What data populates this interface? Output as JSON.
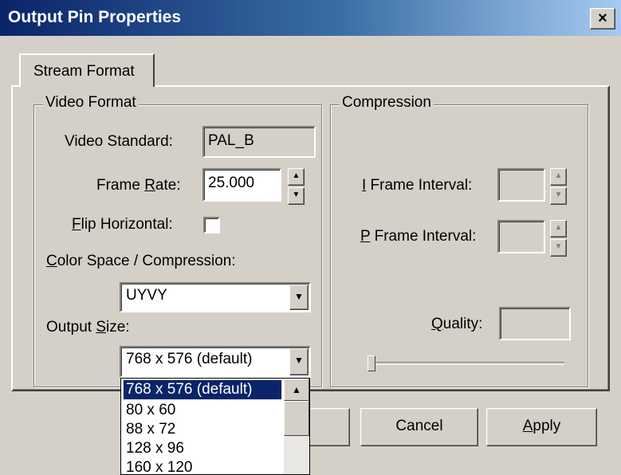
{
  "window": {
    "title": "Output Pin Properties",
    "close_glyph": "×"
  },
  "tabs": [
    {
      "label": "Stream Format"
    }
  ],
  "video_format": {
    "legend": "Video Format",
    "video_standard": {
      "label": "Video Standard:",
      "value": "PAL_B"
    },
    "frame_rate": {
      "label_pre": "Frame ",
      "label_key": "R",
      "label_post": "ate:",
      "value": "25.000"
    },
    "flip_horizontal": {
      "label_key": "F",
      "label_post": "lip Horizontal:",
      "checked": false
    },
    "color_space": {
      "label_key": "C",
      "label_post": "olor Space / Compression:",
      "value": "UYVY"
    },
    "output_size": {
      "label_pre": "Output ",
      "label_key": "S",
      "label_post": "ize:",
      "value": "768 x 576  (default)"
    }
  },
  "compression": {
    "legend": "Compression",
    "i_frame": {
      "label_key": "I",
      "label_post": " Frame Interval:",
      "value": ""
    },
    "p_frame": {
      "label_key": "P",
      "label_post": " Frame Interval:",
      "value": ""
    },
    "quality": {
      "label_key": "Q",
      "label_post": "uality:",
      "value": ""
    }
  },
  "output_size_options": [
    {
      "label": "768 x 576  (default)",
      "selected": true
    },
    {
      "label": "80 x 60",
      "selected": false
    },
    {
      "label": "88 x 72",
      "selected": false
    },
    {
      "label": "128 x 96",
      "selected": false
    },
    {
      "label": "160 x 120",
      "selected": false
    }
  ],
  "buttons": {
    "cancel": "Cancel",
    "apply_key": "A",
    "apply_post": "pply"
  },
  "icons": {
    "spin_up": "▲",
    "spin_down": "▼",
    "dropdown_arrow": "▼",
    "scroll_up": "▲"
  },
  "colors": {
    "selection": "#0a246a",
    "face": "#d4d0c8"
  }
}
